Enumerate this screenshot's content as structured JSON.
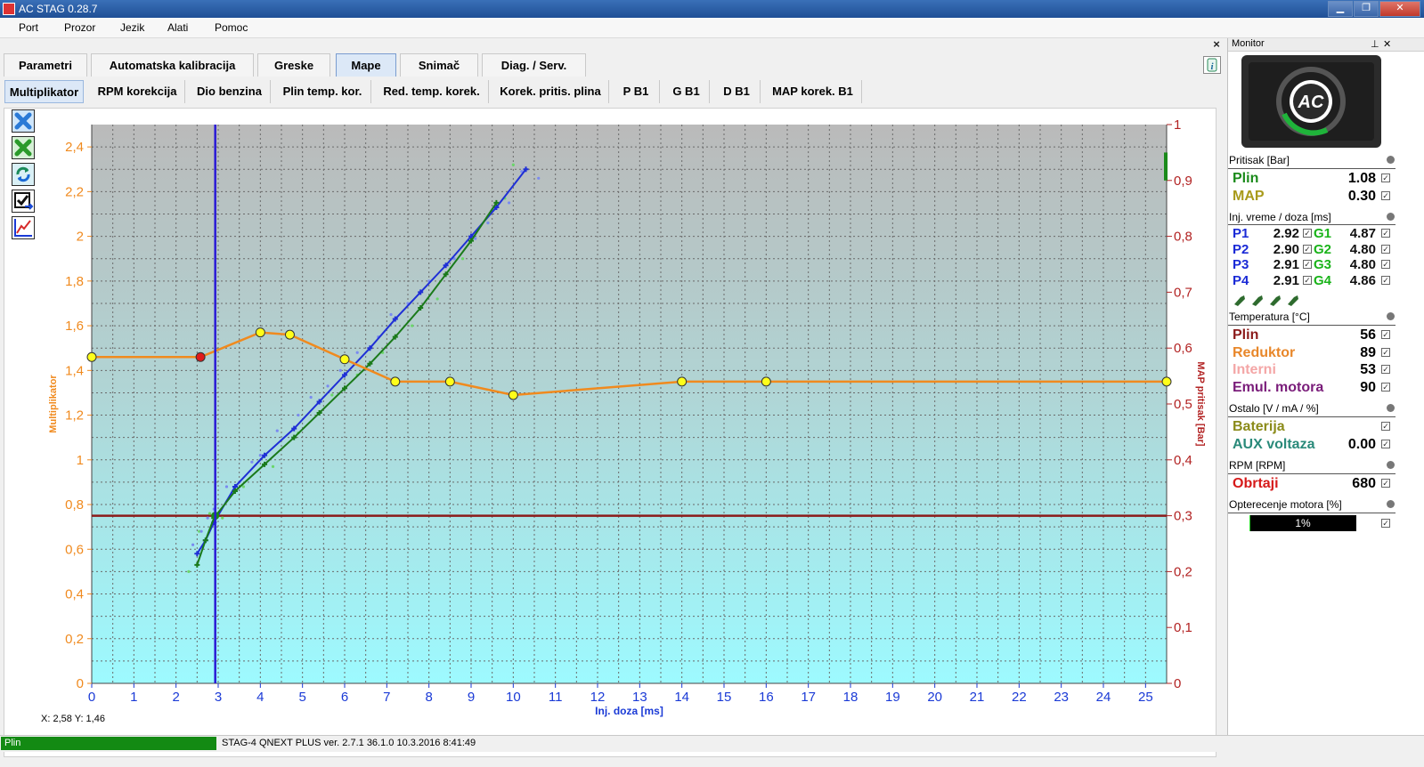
{
  "window": {
    "title": "AC STAG 0.28.7"
  },
  "menu": [
    "Port",
    "Prozor",
    "Jezik",
    "Alati",
    "Pomoc"
  ],
  "tabs_main": [
    "Parametri",
    "Automatska kalibracija",
    "Greske",
    "Mape",
    "Snimač",
    "Diag. / Serv."
  ],
  "tabs_sub": [
    "Multiplikator",
    "RPM korekcija",
    "Dio benzina",
    "Plin temp. kor.",
    "Red. temp. korek.",
    "Korek. pritis. plina",
    "P B1",
    "G B1",
    "D B1",
    "MAP korek. B1"
  ],
  "coords": "X: 2,58  Y: 1,46",
  "status": {
    "fuel": "Plin",
    "info": "STAG-4 QNEXT PLUS  ver. 2.7.1  36.1.0  10.3.2016 8:41:49"
  },
  "monitor": {
    "title": "Monitor",
    "pin": "⊥",
    "close": "✕",
    "pressure": {
      "title": "Pritisak [Bar]",
      "plin_label": "Plin",
      "plin_value": "1.08",
      "map_label": "MAP",
      "map_value": "0.30"
    },
    "injection": {
      "title": "Inj. vreme / doza [ms]",
      "rows": [
        {
          "p": "P1",
          "pv": "2.92",
          "g": "G1",
          "gv": "4.87"
        },
        {
          "p": "P2",
          "pv": "2.90",
          "g": "G2",
          "gv": "4.80"
        },
        {
          "p": "P3",
          "pv": "2.91",
          "g": "G3",
          "gv": "4.80"
        },
        {
          "p": "P4",
          "pv": "2.91",
          "g": "G4",
          "gv": "4.86"
        }
      ]
    },
    "temperature": {
      "title": "Temperatura [°C]",
      "rows": [
        {
          "label": "Plin",
          "value": "56",
          "color": "#8b1a1a"
        },
        {
          "label": "Reduktor",
          "value": "89",
          "color": "#e8872a"
        },
        {
          "label": "Interni",
          "value": "53",
          "color": "#f4a6a6"
        },
        {
          "label": "Emul. motora",
          "value": "90",
          "color": "#7a1d7a"
        }
      ]
    },
    "other": {
      "title": "Ostalo [V / mA / %]",
      "rows": [
        {
          "label": "Baterija",
          "value": "",
          "color": "#8b8b1a"
        },
        {
          "label": "AUX voltaza",
          "value": "0.00",
          "color": "#2a8a7a"
        }
      ]
    },
    "rpm": {
      "title": "RPM [RPM]",
      "label": "Obrtaji",
      "value": "680"
    },
    "load": {
      "title": "Opterecenje motora [%]",
      "value": "1%",
      "fraction": 0.01
    }
  },
  "chart_data": {
    "type": "line",
    "xlabel": "Inj. doza [ms]",
    "ylabel": "Multiplikator",
    "y2label": "MAP pritisak [Bar]",
    "xlim": [
      0,
      25.5
    ],
    "ylim": [
      0,
      2.5
    ],
    "y2lim": [
      0,
      1
    ],
    "x_ticks": [
      "0",
      "1",
      "2",
      "3",
      "4",
      "5",
      "6",
      "7",
      "8",
      "9",
      "10",
      "11",
      "12",
      "13",
      "14",
      "15",
      "16",
      "17",
      "18",
      "19",
      "20",
      "21",
      "22",
      "23",
      "24",
      "25"
    ],
    "y_ticks": [
      "0",
      "0,2",
      "0,4",
      "0,6",
      "0,8",
      "1",
      "1,2",
      "1,4",
      "1,6",
      "1,8",
      "2",
      "2,2",
      "2,4"
    ],
    "y2_ticks": [
      "0",
      "0,1",
      "0,2",
      "0,3",
      "0,4",
      "0,5",
      "0,6",
      "0,7",
      "0,8",
      "0,9",
      "1"
    ],
    "cursor_x": 2.93,
    "map_level": 0.3,
    "multiplier": {
      "x": [
        0,
        2.58,
        4,
        4.7,
        6,
        7.2,
        8.5,
        10,
        14,
        16,
        25.5
      ],
      "y": [
        1.46,
        1.46,
        1.57,
        1.56,
        1.45,
        1.35,
        1.35,
        1.29,
        1.35,
        1.35,
        1.35
      ],
      "selected_index": 1,
      "color": "#f08a1e"
    },
    "series": [
      {
        "color": "#1f2fd6",
        "x": [
          2.5,
          2.7,
          2.9,
          3.4,
          4.1,
          4.8,
          5.4,
          6.0,
          6.6,
          7.2,
          7.8,
          8.4,
          9.0,
          9.6,
          10.3
        ],
        "y": [
          0.58,
          0.64,
          0.72,
          0.88,
          1.02,
          1.14,
          1.26,
          1.38,
          1.5,
          1.63,
          1.75,
          1.87,
          2.0,
          2.13,
          2.3
        ]
      },
      {
        "color": "#1a7a1a",
        "x": [
          2.5,
          2.7,
          2.9,
          3.4,
          4.1,
          4.8,
          5.4,
          6.0,
          6.6,
          7.2,
          7.8,
          8.4,
          9.0,
          9.6
        ],
        "y": [
          0.53,
          0.64,
          0.74,
          0.86,
          0.98,
          1.1,
          1.21,
          1.32,
          1.43,
          1.55,
          1.68,
          1.83,
          1.98,
          2.15
        ]
      }
    ],
    "scatter_blue": {
      "x": [
        2.4,
        2.6,
        2.75,
        2.9,
        3.2,
        3.5,
        3.8,
        4.0,
        4.4,
        4.9,
        5.2,
        5.6,
        5.9,
        6.3,
        6.8,
        7.1,
        7.5,
        8.0,
        8.6,
        9.1,
        9.4,
        9.9,
        10.2,
        10.6
      ],
      "y": [
        0.62,
        0.68,
        0.74,
        0.78,
        0.88,
        0.9,
        0.99,
        1.02,
        1.13,
        1.2,
        1.28,
        1.33,
        1.4,
        1.48,
        1.55,
        1.65,
        1.7,
        1.8,
        1.9,
        1.99,
        2.06,
        2.15,
        2.29,
        2.26
      ]
    },
    "scatter_green": {
      "x": [
        2.3,
        2.55,
        2.8,
        3.1,
        3.6,
        4.3,
        4.9,
        5.7,
        6.3,
        6.9,
        7.6,
        8.2,
        8.8,
        9.4,
        9.8,
        10.0
      ],
      "y": [
        0.5,
        0.68,
        0.76,
        0.74,
        0.88,
        0.97,
        1.12,
        1.29,
        1.38,
        1.48,
        1.6,
        1.72,
        1.9,
        2.06,
        2.17,
        2.32
      ]
    }
  }
}
